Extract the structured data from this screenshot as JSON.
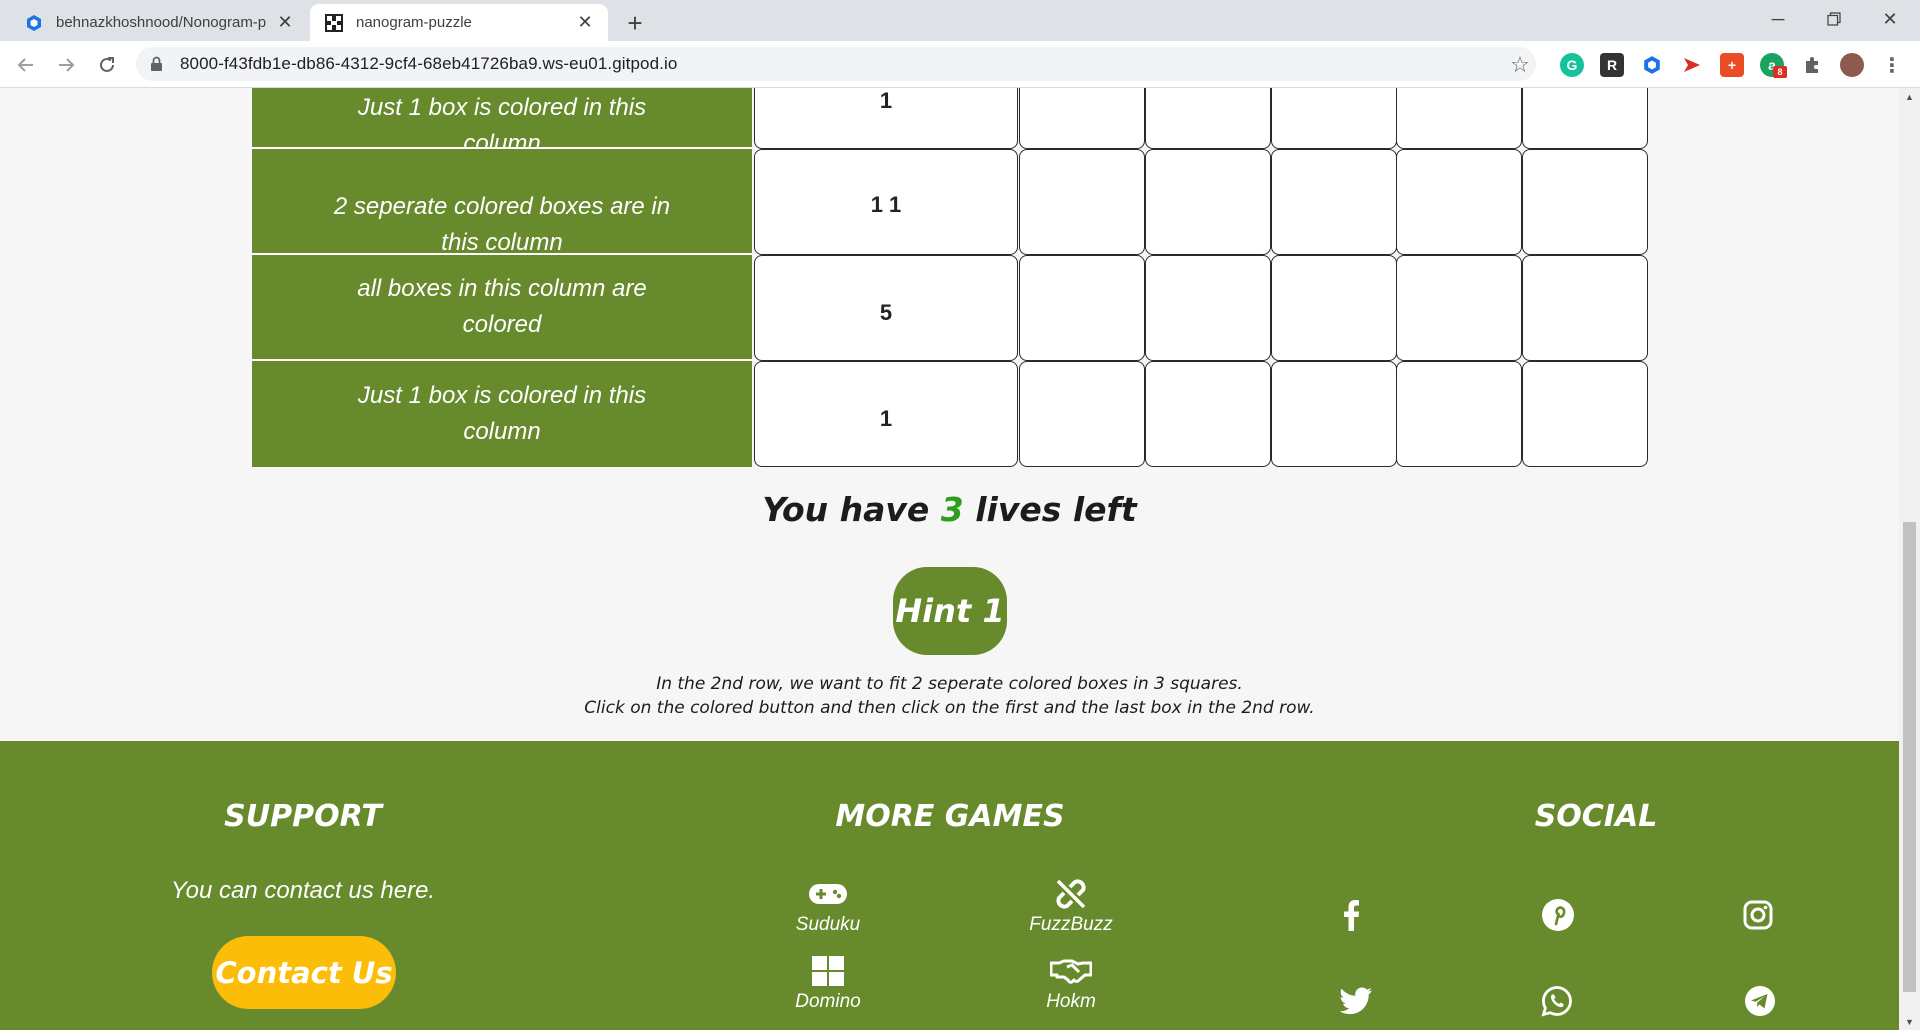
{
  "browser": {
    "tabs": [
      {
        "title": "behnazkhoshnood/Nonogram-p",
        "active": false
      },
      {
        "title": "nanogram-puzzle",
        "active": true
      }
    ],
    "url": "8000-f43fdb1e-db86-4312-9cf4-68eb41726ba9.ws-eu01.gitpod.io",
    "extension_badge": "8"
  },
  "puzzle": {
    "rows": [
      {
        "clue_text": "Just 1 box is colored in this column",
        "clue_number": "1"
      },
      {
        "clue_text": "2 seperate colored boxes are in this column",
        "clue_number": "1 1"
      },
      {
        "clue_text": "all boxes in this column are colored",
        "clue_number": "5"
      },
      {
        "clue_text": "Just 1 box is colored in this column",
        "clue_number": "1"
      }
    ]
  },
  "status": {
    "lives_prefix": "You have",
    "lives_count": "3",
    "lives_suffix": "lives left"
  },
  "hint": {
    "button_label": "Hint 1",
    "line1": "In the 2nd row, we want to fit 2 seperate colored boxes in 3 squares.",
    "line2": "Click on the colored button and then click on the first and the last box in the 2nd row."
  },
  "footer": {
    "support": {
      "title": "SUPPORT",
      "text": "You can contact us here.",
      "button_label": "Contact Us"
    },
    "more_games": {
      "title": "MORE GAMES",
      "games": [
        "Suduku",
        "FuzzBuzz",
        "Domino",
        "Hokm"
      ]
    },
    "social": {
      "title": "SOCIAL",
      "icons": [
        "facebook-icon",
        "pinterest-icon",
        "instagram-icon",
        "twitter-icon",
        "whatsapp-icon",
        "telegram-icon"
      ]
    }
  },
  "colors": {
    "brand_green": "#678a2c",
    "accent_yellow": "#fbbd08",
    "lives_green": "#2e9e1e"
  }
}
